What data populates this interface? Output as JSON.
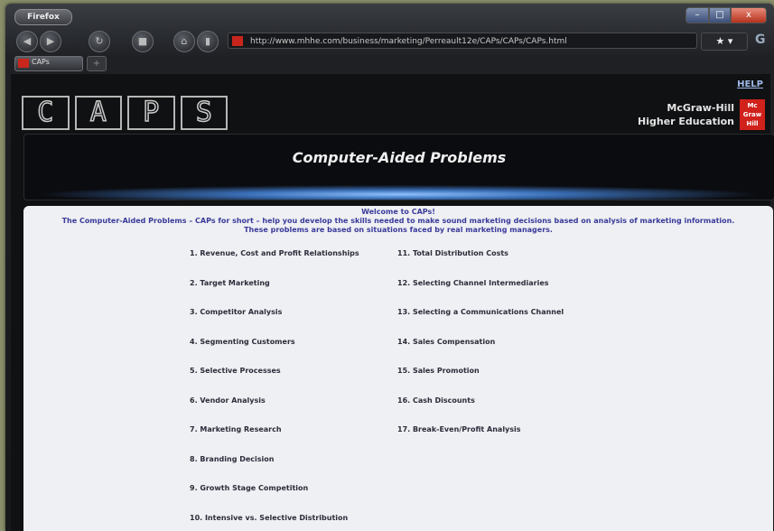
{
  "browser": {
    "menu_label": "Firefox",
    "controls": {
      "minimize": "–",
      "maximize": "□",
      "close": "x"
    },
    "url": "http://www.mhhe.com/business/marketing/Perreault12e/CAPs/CAPs/CAPs.html",
    "tab_label": "CAPs",
    "new_tab": "+"
  },
  "header": {
    "help": "HELP",
    "logo_letters": [
      "C",
      "A",
      "P",
      "S"
    ],
    "publisher_line1": "McGraw-Hill",
    "publisher_line2": "Higher Education",
    "mh_logo": [
      "Mc",
      "Graw",
      "Hill"
    ],
    "banner_title": "Computer-Aided Problems"
  },
  "intro": {
    "heading": "Welcome to CAPs!",
    "line1": "The Computer-Aided Problems – CAPs for short – help you develop the skills needed to make sound marketing decisions based on analysis of marketing information.",
    "line2": "These problems are based on situations faced by real marketing managers."
  },
  "problems_left": [
    "1. Revenue, Cost and Profit Relationships",
    "2. Target Marketing",
    "3. Competitor Analysis",
    "4. Segmenting Customers",
    "5. Selective Processes",
    "6. Vendor Analysis",
    "7. Marketing Research",
    "8. Branding Decision",
    "9. Growth Stage Competition",
    "10. Intensive vs. Selective Distribution"
  ],
  "problems_right": [
    "11. Total Distribution Costs",
    "12. Selecting Channel Intermediaries",
    "13. Selecting a Communications Channel",
    "14. Sales Compensation",
    "15. Sales Promotion",
    "16. Cash Discounts",
    "17. Break-Even/Profit Analysis"
  ],
  "colors": {
    "accent": "#3b3a9a",
    "brand_red": "#d0211b"
  }
}
